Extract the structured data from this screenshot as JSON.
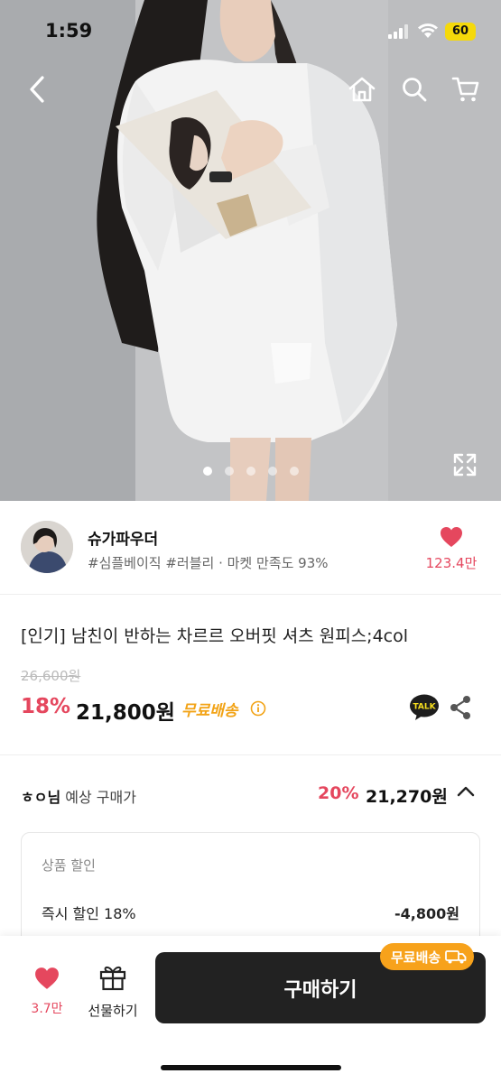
{
  "status_bar": {
    "time": "1:59",
    "battery": "60"
  },
  "gallery": {
    "total_images": 5,
    "active_index": 0
  },
  "seller": {
    "name": "슈가파우더",
    "tags": "#심플베이직 #러블리 · 마켓 만족도 93%",
    "like_count": "123.4만"
  },
  "product": {
    "title": "[인기] 남친이 반하는 차르르 오버핏 셔츠 원피스;4col",
    "original_price": "26,600원",
    "discount_rate": "18%",
    "price": "21,800원",
    "free_shipping": "무료배송"
  },
  "expected_price": {
    "user_name": "ㅎㅇ님",
    "label": "예상 구매가",
    "discount_rate": "20%",
    "price": "21,270원"
  },
  "discount_details": {
    "section_title": "상품 할인",
    "items": [
      {
        "label": "즉시 할인 18%",
        "value": "-4,800원"
      }
    ]
  },
  "bottom_bar": {
    "like_count": "3.7만",
    "gift_label": "선물하기",
    "buy_label": "구매하기",
    "free_shipping_badge": "무료배송"
  },
  "colors": {
    "accent_pink": "#e5475e",
    "shipping_orange": "#f2a316",
    "buy_button": "#222222"
  }
}
